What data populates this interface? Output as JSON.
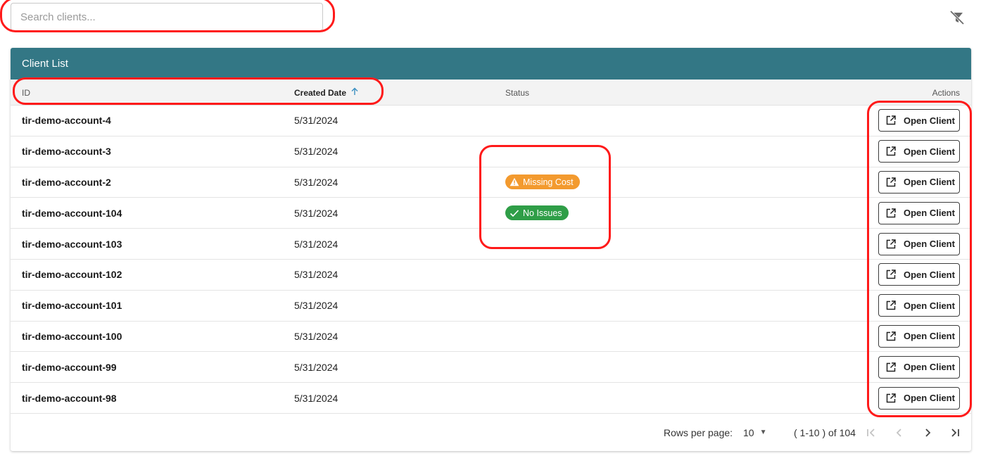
{
  "search": {
    "placeholder": "Search clients..."
  },
  "toolbar": {
    "clear_filters_icon": "filter-off-icon"
  },
  "card": {
    "title": "Client List"
  },
  "table": {
    "headers": {
      "id": "ID",
      "created_date": "Created Date",
      "status": "Status",
      "actions": "Actions"
    },
    "sort": {
      "column": "Created Date",
      "direction": "ascending",
      "icon": "arrow-up-icon"
    },
    "rows": [
      {
        "id": "tir-demo-account-4",
        "created": "5/31/2024",
        "status": "",
        "action": "Open Client"
      },
      {
        "id": "tir-demo-account-3",
        "created": "5/31/2024",
        "status": "",
        "action": "Open Client"
      },
      {
        "id": "tir-demo-account-2",
        "created": "5/31/2024",
        "status": "Missing Cost",
        "status_type": "warning",
        "action": "Open Client"
      },
      {
        "id": "tir-demo-account-104",
        "created": "5/31/2024",
        "status": "No Issues",
        "status_type": "success",
        "action": "Open Client"
      },
      {
        "id": "tir-demo-account-103",
        "created": "5/31/2024",
        "status": "",
        "action": "Open Client"
      },
      {
        "id": "tir-demo-account-102",
        "created": "5/31/2024",
        "status": "",
        "action": "Open Client"
      },
      {
        "id": "tir-demo-account-101",
        "created": "5/31/2024",
        "status": "",
        "action": "Open Client"
      },
      {
        "id": "tir-demo-account-100",
        "created": "5/31/2024",
        "status": "",
        "action": "Open Client"
      },
      {
        "id": "tir-demo-account-99",
        "created": "5/31/2024",
        "status": "",
        "action": "Open Client"
      },
      {
        "id": "tir-demo-account-98",
        "created": "5/31/2024",
        "status": "",
        "action": "Open Client"
      }
    ]
  },
  "pagination": {
    "rows_per_page_label": "Rows per page:",
    "rows_per_page": "10",
    "range": "( 1-10 ) of 104"
  },
  "colors": {
    "header_bg": "#337785",
    "warning": "#f39a2e",
    "success": "#2f9e47",
    "sort_arrow": "#3a8fc2",
    "annotation": "#ff1a1a"
  }
}
